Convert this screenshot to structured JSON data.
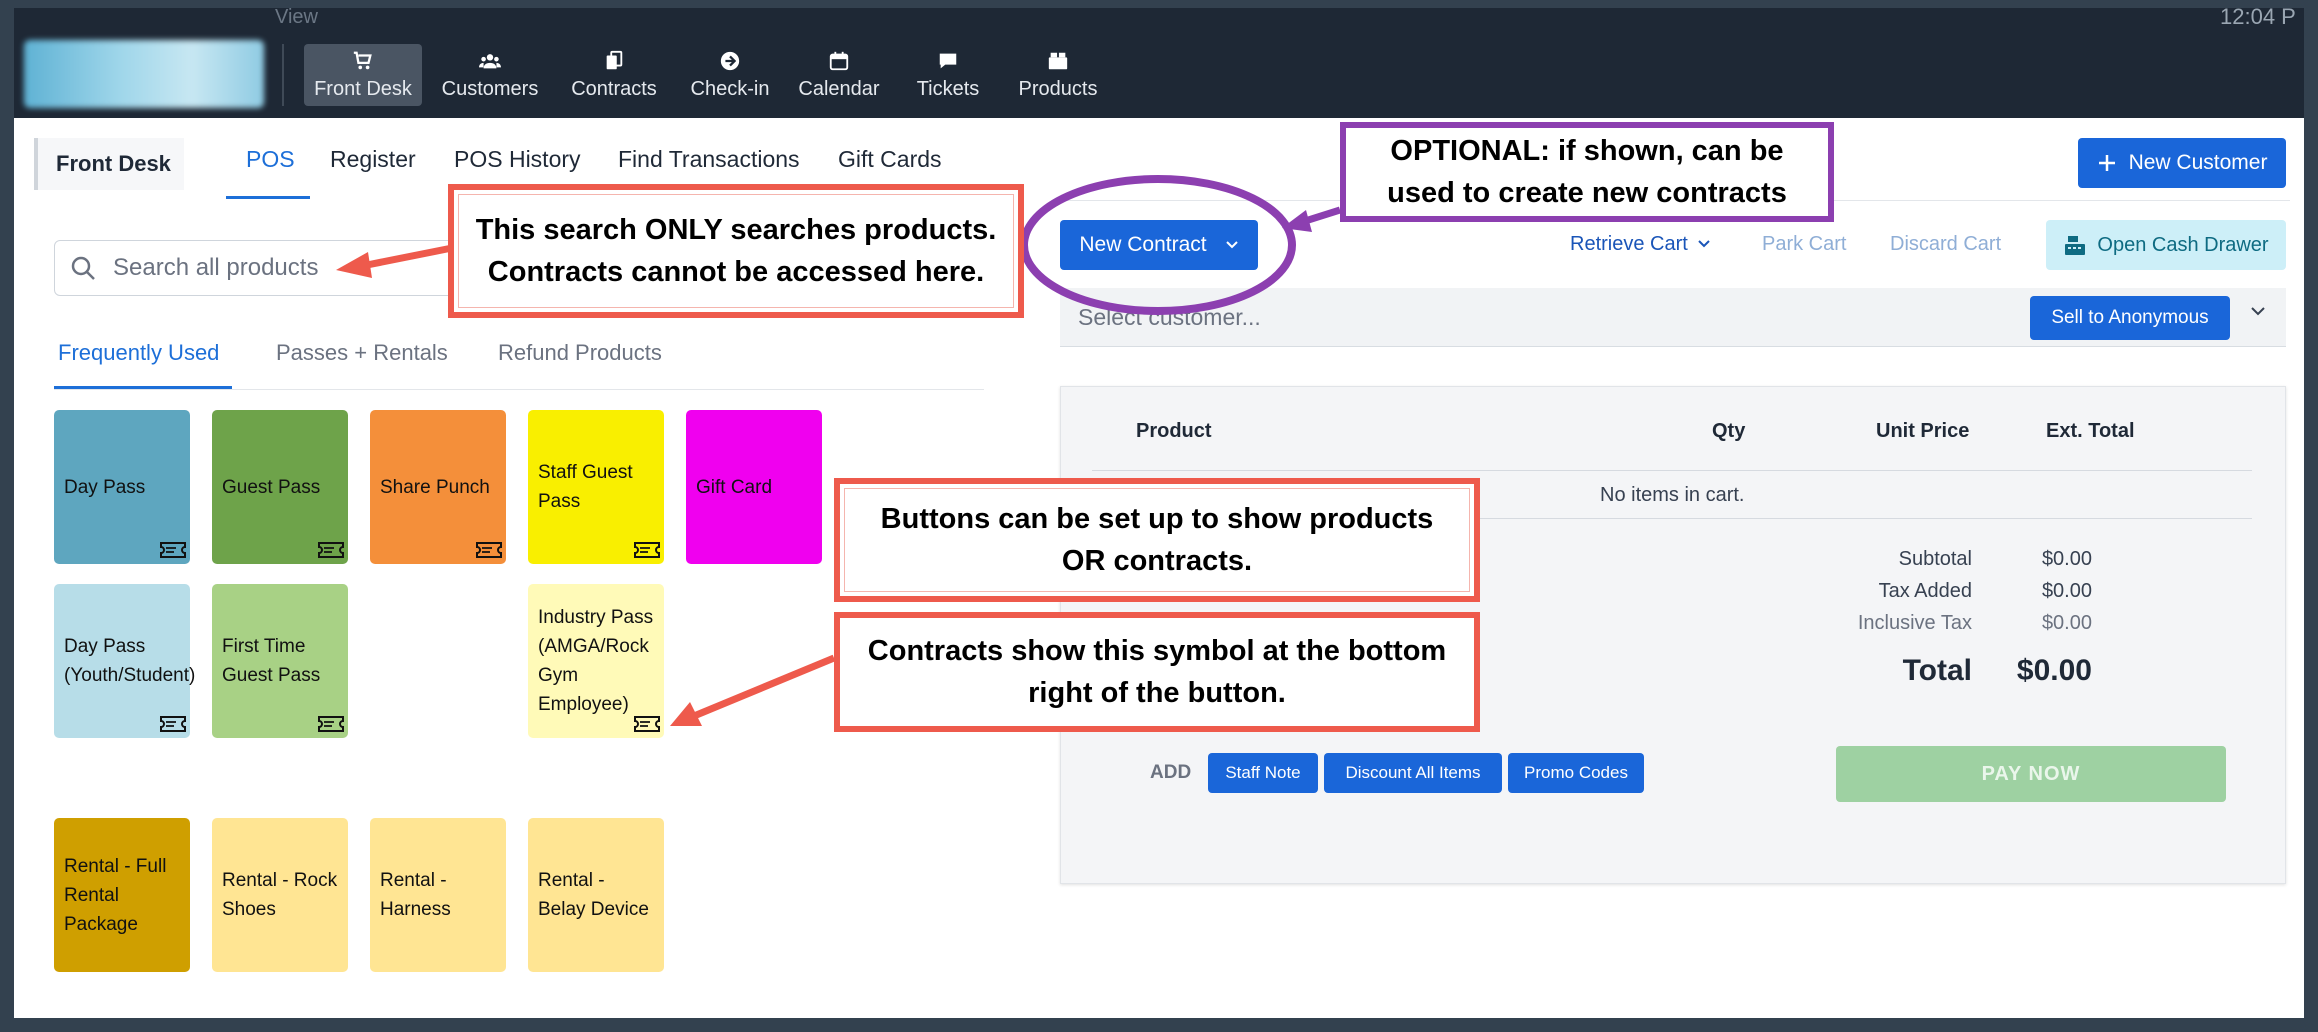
{
  "topbar": {
    "view_label": "View",
    "clock": "12:04 P",
    "nav": [
      {
        "label": "Front Desk",
        "icon": "cart-icon"
      },
      {
        "label": "Customers",
        "icon": "users-icon"
      },
      {
        "label": "Contracts",
        "icon": "contracts-icon"
      },
      {
        "label": "Check-in",
        "icon": "arrow-circle-icon"
      },
      {
        "label": "Calendar",
        "icon": "calendar-icon"
      },
      {
        "label": "Tickets",
        "icon": "chat-icon"
      },
      {
        "label": "Products",
        "icon": "boxes-icon"
      }
    ]
  },
  "subnav": {
    "section": "Front Desk",
    "tabs": [
      "POS",
      "Register",
      "POS History",
      "Find Transactions",
      "Gift Cards"
    ],
    "active_tab": "POS",
    "new_customer": "New Customer"
  },
  "search": {
    "placeholder": "Search all products"
  },
  "product_tabs": {
    "items": [
      "Frequently Used",
      "Passes + Rentals",
      "Refund Products"
    ],
    "active": "Frequently Used"
  },
  "tiles": [
    {
      "label": "Day Pass",
      "color": "#5ea6bf",
      "contract": true
    },
    {
      "label": "Guest Pass",
      "color": "#6ea34a",
      "contract": true
    },
    {
      "label": "Share Punch",
      "color": "#f48f3a",
      "contract": true
    },
    {
      "label": "Staff Guest Pass",
      "color": "#f9ef00",
      "contract": true
    },
    {
      "label": "Gift Card",
      "color": "#f000ef",
      "contract": false
    },
    {
      "label": "Day Pass (Youth/Student)",
      "color": "#b7dde8",
      "contract": true
    },
    {
      "label": "First Time Guest Pass",
      "color": "#a8d185",
      "contract": true
    },
    {
      "label": "Industry Pass (AMGA/Rock Gym Employee)",
      "color": "#fffab8",
      "contract": true
    },
    {
      "label": "Rental - Full Rental Package",
      "color": "#cf9f00",
      "contract": false
    },
    {
      "label": "Rental - Rock Shoes",
      "color": "#ffe593",
      "contract": false
    },
    {
      "label": "Rental - Harness",
      "color": "#ffe593",
      "contract": false
    },
    {
      "label": "Rental - Belay Device",
      "color": "#ffe593",
      "contract": false
    }
  ],
  "cart_actions": {
    "new_contract": "New Contract",
    "retrieve_cart": "Retrieve Cart",
    "park_cart": "Park Cart",
    "discard_cart": "Discard Cart",
    "open_cash_drawer": "Open Cash Drawer"
  },
  "customer": {
    "placeholder": "Select customer...",
    "sell_anonymous": "Sell to Anonymous"
  },
  "cart": {
    "headers": {
      "product": "Product",
      "qty": "Qty",
      "unit_price": "Unit Price",
      "ext_total": "Ext. Total"
    },
    "empty_text": "No items in cart.",
    "subtotal_label": "Subtotal",
    "subtotal": "$0.00",
    "tax_added_label": "Tax Added",
    "tax_added": "$0.00",
    "inclusive_tax_label": "Inclusive Tax",
    "inclusive_tax": "$0.00",
    "total_label": "Total",
    "total": "$0.00",
    "add_label": "ADD",
    "staff_note": "Staff Note",
    "discount_all": "Discount All Items",
    "promo_codes": "Promo Codes",
    "pay_now": "PAY NOW"
  },
  "annotations": {
    "search_note": "This search ONLY searches products. Contracts cannot be accessed here.",
    "optional_note": "OPTIONAL: if shown, can be used to create new contracts",
    "buttons_note": "Buttons can be set up to show products OR contracts.",
    "symbol_note": "Contracts show this symbol at the bottom right of the button."
  },
  "colors": {
    "accent": "#1a66d9",
    "annotation_red": "#ee5a4c",
    "annotation_purple": "#8c3fb0"
  }
}
